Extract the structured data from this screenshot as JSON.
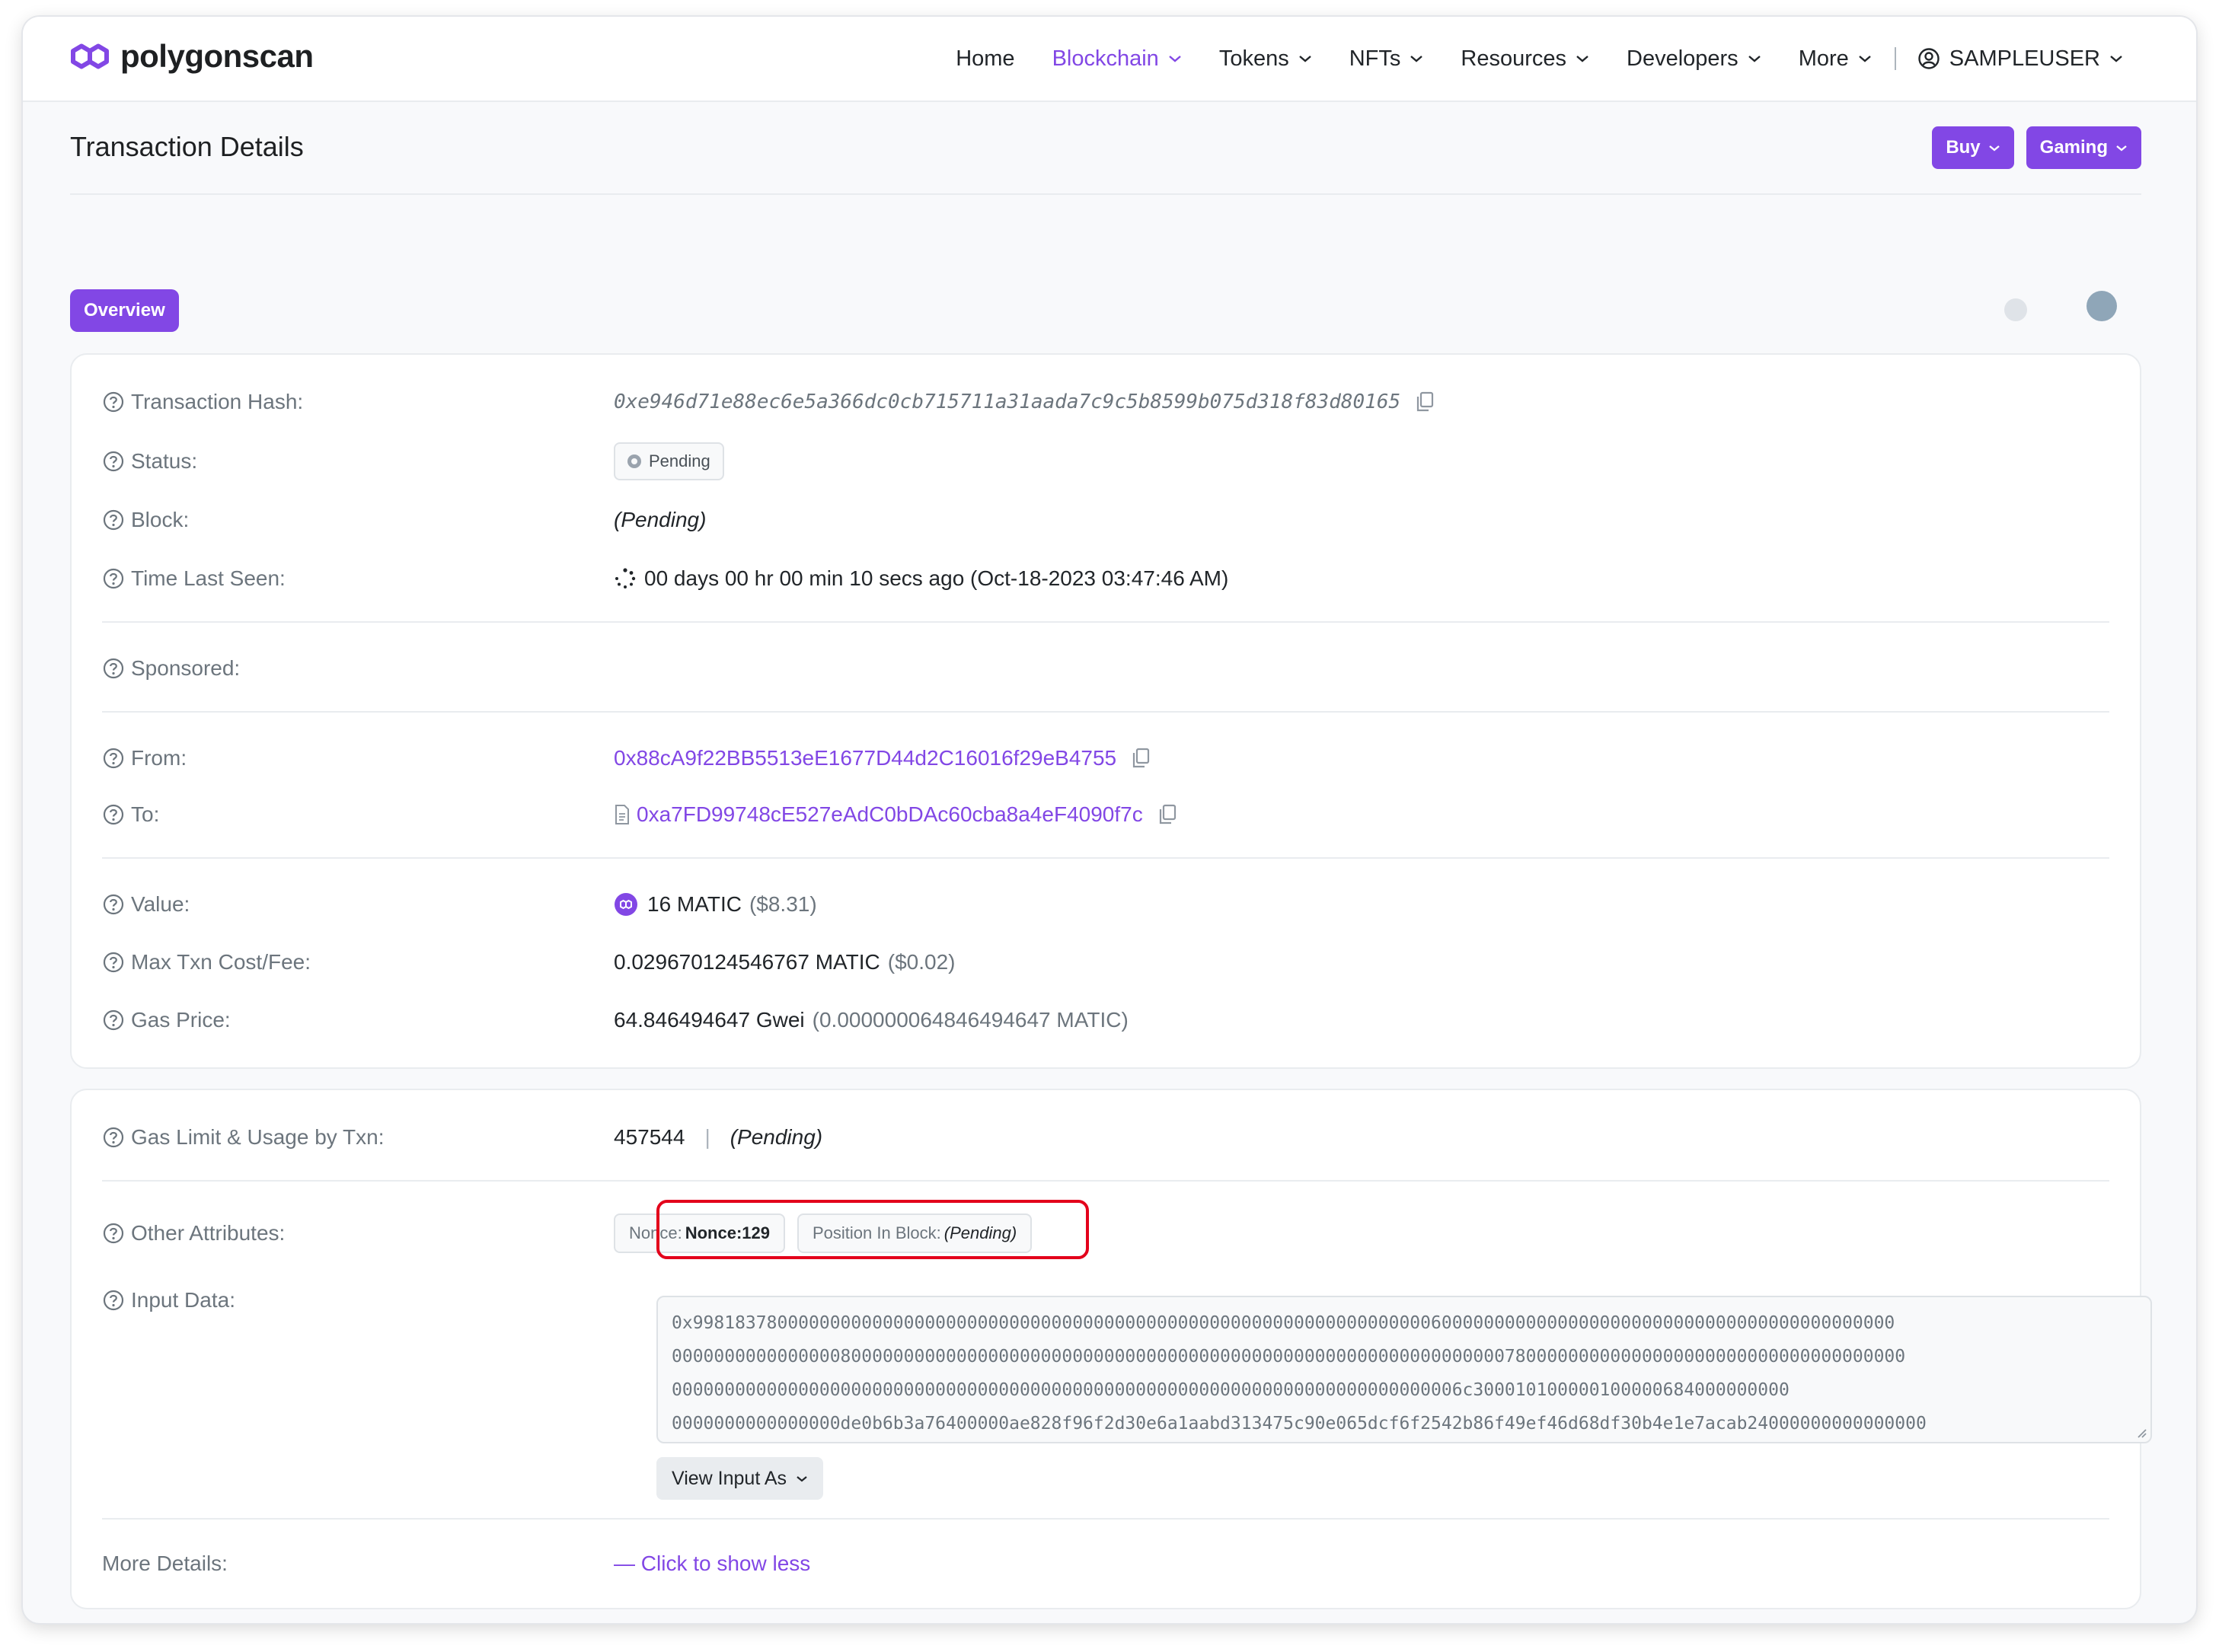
{
  "header": {
    "logo_text": "polygonscan",
    "nav": [
      {
        "label": "Home"
      },
      {
        "label": "Blockchain",
        "active": true
      },
      {
        "label": "Tokens"
      },
      {
        "label": "NFTs"
      },
      {
        "label": "Resources"
      },
      {
        "label": "Developers"
      },
      {
        "label": "More"
      }
    ],
    "user_label": "SAMPLEUSER"
  },
  "page": {
    "title": "Transaction Details",
    "buttons": {
      "buy": "Buy",
      "gaming": "Gaming"
    },
    "tabs": {
      "overview": "Overview"
    }
  },
  "overview": {
    "tx_hash": {
      "label": "Transaction Hash:",
      "value": "0xe946d71e88ec6e5a366dc0cb715711a31aada7c9c5b8599b075d318f83d80165"
    },
    "status": {
      "label": "Status:",
      "value": "Pending"
    },
    "block": {
      "label": "Block:",
      "value": "(Pending)"
    },
    "time_last_seen": {
      "label": "Time Last Seen:",
      "value": "00 days 00 hr 00 min 10 secs ago (Oct-18-2023 03:47:46 AM)"
    },
    "sponsored": {
      "label": "Sponsored:"
    },
    "from": {
      "label": "From:",
      "value": "0x88cA9f22BB5513eE1677D44d2C16016f29eB4755"
    },
    "to": {
      "label": "To:",
      "value": "0xa7FD99748cE527eAdC0bDAc60cba8a4eF4090f7c"
    },
    "value": {
      "label": "Value:",
      "amount": "16 MATIC",
      "usd": "($8.31)"
    },
    "max_txn_cost": {
      "label": "Max Txn Cost/Fee:",
      "amount": "0.029670124546767 MATIC",
      "usd": "($0.02)"
    },
    "gas_price": {
      "label": "Gas Price:",
      "amount": "64.846494647 Gwei",
      "detail": "(0.000000064846494647 MATIC)"
    }
  },
  "details": {
    "gas_limit": {
      "label": "Gas Limit & Usage by Txn:",
      "limit": "457544",
      "separator": "|",
      "usage": "(Pending)"
    },
    "other_attributes": {
      "label": "Other Attributes:",
      "nonce_label": "Nonce:",
      "nonce_value": "Nonce:129",
      "position_label": "Position In Block:",
      "position_value": "(Pending)"
    },
    "input_data": {
      "label": "Input Data:",
      "lines": [
        "0x998183780000000000000000000000000000000000000000000000000000000000000060000000000000000000000000000000000000000000",
        "000000000000000080000000000000000000000000000000000000000000000000000000000000078000000000000000000000000000000000000",
        "000000000000000000000000000000000000000000000000000000000000000000000000006c300010100000100000684000000000",
        "0000000000000000de0b6b3a76400000ae828f96f2d30e6a1aabd313475c90e065dcf6f2542b86f49ef46d68df30b4e1e7acab24000000000000000"
      ],
      "view_button": "View Input As"
    },
    "more_details": {
      "label": "More Details:",
      "link": "— Click to show less"
    }
  },
  "colors": {
    "accent": "#8247e5",
    "highlight_box": "#e3001b"
  }
}
